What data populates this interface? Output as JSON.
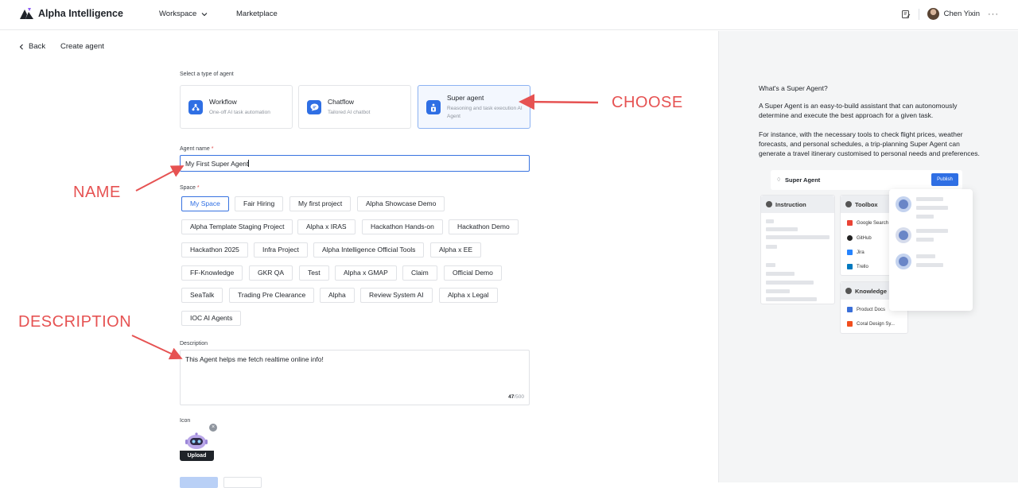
{
  "app": {
    "brand_name": "Alpha Intelligence",
    "nav": {
      "workspace": "Workspace",
      "marketplace": "Marketplace"
    },
    "user_name": "Chen Yixin",
    "more": "···"
  },
  "breadcrumb": {
    "back": "Back",
    "current": "Create agent"
  },
  "form": {
    "type_label": "Select a type of agent",
    "types": [
      {
        "title": "Workflow",
        "desc": "One-off AI task automation",
        "selected": false
      },
      {
        "title": "Chatflow",
        "desc": "Tailored AI chatbot",
        "selected": false
      },
      {
        "title": "Super agent",
        "desc": "Reasoning and task execution AI Agent",
        "selected": true
      }
    ],
    "name_label": "Agent name",
    "name_value": "My First Super Agent",
    "space_label": "Space",
    "required_mark": "*",
    "spaces": [
      [
        "My Space",
        "Fair Hiring",
        "My first project",
        "Alpha Showcase Demo"
      ],
      [
        "Alpha Template Staging Project",
        "Alpha x IRAS",
        "Hackathon Hands-on",
        "Hackathon Demo"
      ],
      [
        "Hackathon 2025",
        "Infra Project",
        "Alpha Intelligence Official Tools",
        "Alpha x EE"
      ],
      [
        "FF-Knowledge",
        "GKR QA",
        "Test",
        "Alpha x GMAP",
        "Claim",
        "Official Demo"
      ],
      [
        "SeaTalk",
        "Trading Pre Clearance",
        "Alpha",
        "Review System AI",
        "Alpha x Legal"
      ],
      [
        "IOC AI Agents"
      ]
    ],
    "selected_space": "My Space",
    "description_label": "Description",
    "description_value": "This Agent helps me fetch realtime online info!",
    "char_count": "47",
    "char_max": "/500",
    "icon_label": "Icon",
    "upload_label": "Upload",
    "close_glyph": "×"
  },
  "annotations": {
    "choose": "CHOOSE",
    "name": "NAME",
    "description": "DESCRIPTION",
    "color": "#e65252"
  },
  "right_panel": {
    "title": "What's a Super Agent?",
    "p1": "A Super Agent is an easy-to-build assistant that can autonomously determine and execute the best approach for a given task.",
    "p2": "For instance, with the necessary tools to check flight prices, weather forecasts, and personal schedules, a trip-planning Super Agent can generate a travel itinerary customised to personal needs and preferences.",
    "mock": {
      "title": "Super Agent",
      "publish": "Publish",
      "instruction": "Instruction",
      "toolbox": "Toolbox",
      "knowledge": "Knowledge",
      "tools": [
        "Google Search",
        "GitHub",
        "Jira",
        "Trello"
      ],
      "docs": [
        "Product Docs",
        "Coral Design Sy..."
      ]
    }
  },
  "colors": {
    "accent": "#2f6fe4",
    "border": "#e0e2e6",
    "panel_bg": "#f4f5f6"
  }
}
